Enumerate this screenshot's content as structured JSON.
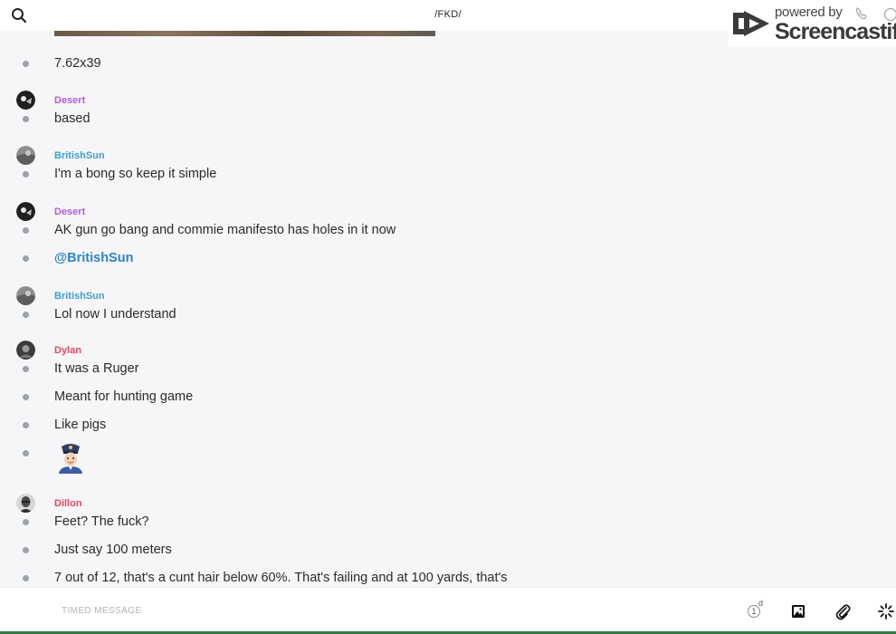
{
  "header": {
    "title": "/FKD/"
  },
  "watermark": {
    "powered_by": "powered by",
    "brand": "Screencastify"
  },
  "authors": {
    "desert": {
      "name": "Desert",
      "color": "#b45bd6"
    },
    "britishsun": {
      "name": "BritishSun",
      "color": "#3b9fd1"
    },
    "dylan": {
      "name": "Dylan",
      "color": "#e0475f"
    },
    "dillon": {
      "name": "Dillon",
      "color": "#e0475f"
    }
  },
  "messages": [
    {
      "text": "7.62x39"
    },
    {
      "author": "Desert",
      "text": "based"
    },
    {
      "author": "BritishSun",
      "text": "I'm a bong so keep it simple"
    },
    {
      "author": "Desert",
      "text": "AK gun go bang and commie manifesto has holes in it now"
    },
    {
      "text": "@BritishSun"
    },
    {
      "author": "BritishSun",
      "text": "Lol now I understand"
    },
    {
      "author": "Dylan",
      "text": "It was a Ruger"
    },
    {
      "text": "Meant for hunting game"
    },
    {
      "text": "Like pigs"
    },
    {
      "emoji": "police-officer-emoji"
    },
    {
      "author": "Dillon",
      "text": "Feet? The fuck?"
    },
    {
      "text": "Just say 100 meters"
    },
    {
      "text": "7 out of 12, that's a cunt hair below 60%. That's failing and at 100 yards, that's"
    }
  ],
  "composer": {
    "placeholder": "TIMED MESSAGE",
    "timer_count": "1",
    "timer_unit": "d",
    "icons": [
      "timer-icon",
      "image-icon",
      "paperclip-icon",
      "loading-spinner-icon"
    ]
  },
  "colors": {
    "bullet": "#9aa2ab",
    "mention": "#2a86c6",
    "background": "#f6f6f8"
  }
}
